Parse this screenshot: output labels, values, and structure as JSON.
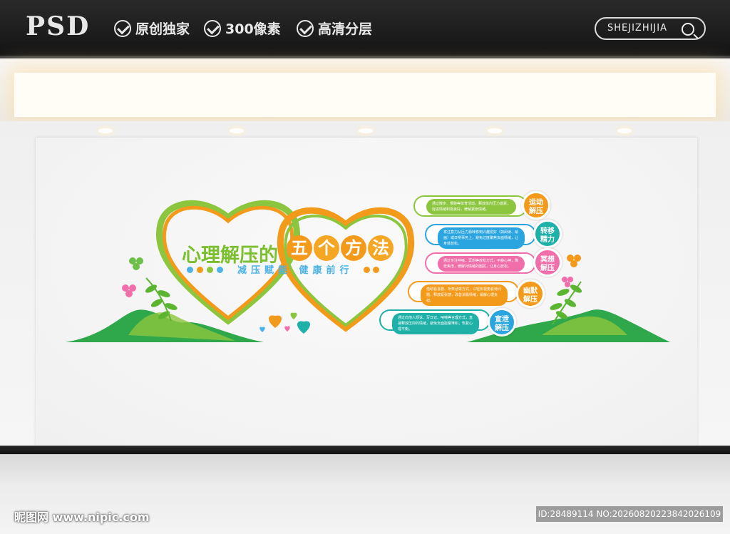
{
  "header": {
    "logo": "PSD",
    "features": [
      "原创独家",
      "300像素",
      "高清分层"
    ],
    "search_label": "SHEJIZHIJIA"
  },
  "display": {
    "title_part1": "心理解压的",
    "title_part2_chars": [
      "五",
      "个",
      "方",
      "法"
    ],
    "subtitle": "减压赋能 健康前行",
    "items": [
      {
        "label": "运动\n解压",
        "text": "通过散步、慢跑等体育活动，释放体内压力激素，促进情绪积极良好，缓解紧张情绪。"
      },
      {
        "label": "转移\n精力",
        "text": "将注意力从压力源转移到兴趣爱好（如阅读、绘画）或日常事务上，避免过度聚焦负面情绪，让身体放松。"
      },
      {
        "label": "冥想\n解压",
        "text": "通过专注呼吸、冥想等放松方式，平静心神，降低焦虑，缓解对情绪的困扰，让身心放松。"
      },
      {
        "label": "幽默\n解压",
        "text": "借助看喜剧、听笑话等方式，以轻松视角看待问题，释放紧张感，改善消极情绪，缓解心理负担。"
      },
      {
        "label": "宣泄\n解压",
        "text": "通过向他人倾诉、写日记、呐喊等合理方式，直接释放压抑的情绪，避免负面能量堆积，恢复心理平衡。"
      }
    ],
    "colors": {
      "green": "#7cbf2e",
      "orange": "#f39a1b",
      "blue": "#2aa5e0",
      "pink": "#f06eaa",
      "teal": "#1fb0a8",
      "hill": "#2ea84a"
    }
  },
  "footer": {
    "watermark": "昵图网 www.nipic.com",
    "id_text": "ID:28489114 NO:20260820223842026109"
  }
}
